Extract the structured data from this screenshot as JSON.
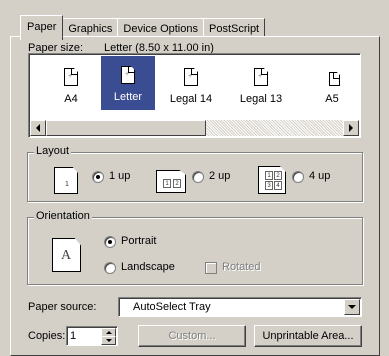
{
  "tabs": [
    "Paper",
    "Graphics",
    "Device Options",
    "PostScript"
  ],
  "paper_size": {
    "label": "Paper size:",
    "value": "Letter (8.50 x 11.00 in)"
  },
  "paper_items": [
    {
      "label": "A4",
      "selected": false
    },
    {
      "label": "Letter",
      "selected": true
    },
    {
      "label": "Legal 14",
      "selected": false
    },
    {
      "label": "Legal 13",
      "selected": false
    },
    {
      "label": "A5",
      "selected": false
    }
  ],
  "layout": {
    "title": "Layout",
    "options": [
      {
        "label": "1 up",
        "checked": true
      },
      {
        "label": "2 up",
        "checked": false
      },
      {
        "label": "4 up",
        "checked": false
      }
    ]
  },
  "orientation": {
    "title": "Orientation",
    "portrait": "Portrait",
    "landscape": "Landscape",
    "rotated": "Rotated",
    "selected": "Portrait",
    "preview_letter": "A"
  },
  "paper_source": {
    "label": "Paper source:",
    "value": "AutoSelect Tray"
  },
  "copies": {
    "label": "Copies:",
    "value": "1"
  },
  "buttons": {
    "custom": "Custom...",
    "unprintable": "Unprintable Area..."
  },
  "colors": {
    "face": "#d4d0c8",
    "selection": "#3a4c92",
    "shadow": "#808080"
  }
}
